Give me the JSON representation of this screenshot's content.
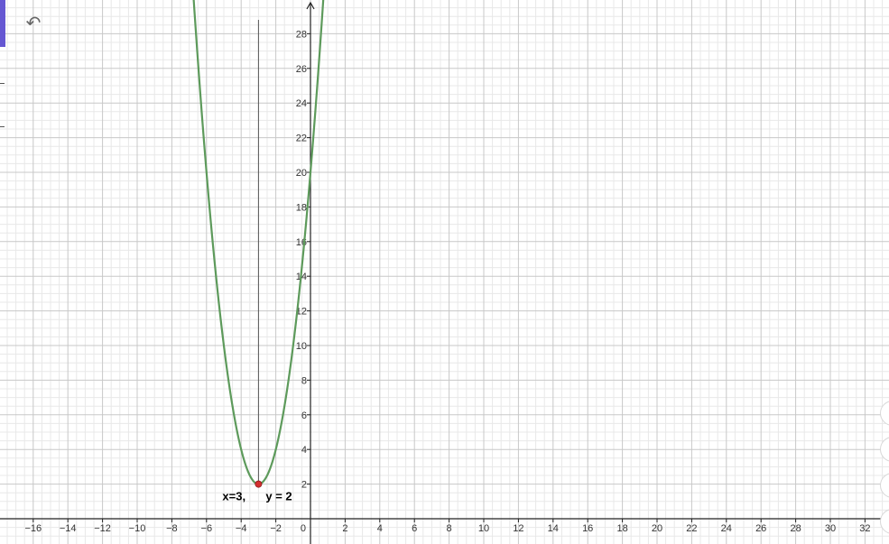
{
  "toolbar": {
    "undo_icon": "undo-icon",
    "undo_glyph": "↶"
  },
  "colors": {
    "curve": "#5d9a5b",
    "point": "#d32f2f",
    "axis": "#222222",
    "grid_major": "#c8c8c8",
    "grid_minor": "#e8e8e8",
    "vertical_line": "#555555"
  },
  "chart_data": {
    "type": "line",
    "title": "",
    "xlabel": "",
    "ylabel": "",
    "xlim": [
      -17.5,
      33
    ],
    "ylim": [
      -1.5,
      29.5
    ],
    "grid": true,
    "x_ticks": [
      -16,
      -14,
      -12,
      -10,
      -8,
      -6,
      -4,
      -2,
      2,
      4,
      6,
      8,
      10,
      12,
      14,
      16,
      18,
      20,
      22,
      24,
      26,
      28,
      30,
      32
    ],
    "y_ticks": [
      2,
      4,
      6,
      8,
      10,
      12,
      14,
      16,
      18,
      20,
      22,
      24,
      26,
      28
    ],
    "tick_labels": {
      "x": [
        "−16",
        "−14",
        "−12",
        "−10",
        "−8",
        "−6",
        "−4",
        "−2",
        "2",
        "4",
        "6",
        "8",
        "10",
        "12",
        "14",
        "16",
        "18",
        "20",
        "22",
        "24",
        "26",
        "28",
        "30",
        "32"
      ],
      "y": [
        "2",
        "4",
        "6",
        "8",
        "10",
        "12",
        "14",
        "16",
        "18",
        "20",
        "22",
        "24",
        "26",
        "28"
      ]
    },
    "origin_label": "0",
    "series": [
      {
        "kind": "parabola",
        "equation_params": {
          "a": 2,
          "h": -3,
          "k": 2
        },
        "x_range": [
          -7,
          1
        ]
      }
    ],
    "vertical_line": {
      "x": -3,
      "y_range": [
        2,
        28.8
      ]
    },
    "point": {
      "x": -3,
      "y": 2
    },
    "annotations": {
      "left": "x=3,",
      "right": "y = 2"
    }
  }
}
